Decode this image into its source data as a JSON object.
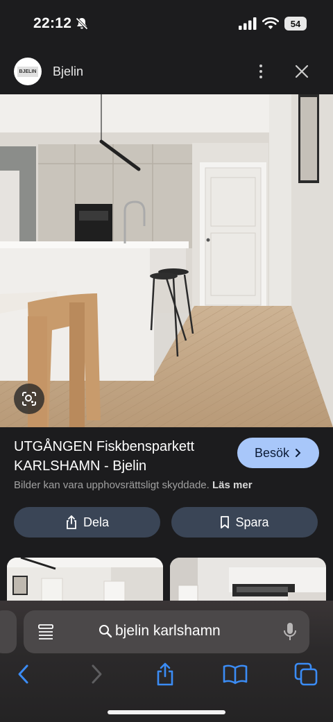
{
  "status_bar": {
    "time": "22:12",
    "battery": "54"
  },
  "header": {
    "site_name": "Bjelin",
    "logo_text": "BJELIN"
  },
  "result": {
    "title": "UTGÅNGEN Fiskbensparkett KARLSHAMN - Bjelin",
    "visit_label": "Besök",
    "copyright_notice": "Bilder kan vara upphovsrättsligt skyddade.",
    "learn_more_label": "Läs mer",
    "share_label": "Dela",
    "save_label": "Spara"
  },
  "browser": {
    "search_query": "bjelin karlshamn"
  },
  "colors": {
    "background": "#1c1c1e",
    "visit_button": "#a8c7fa",
    "action_button": "#3a4556",
    "nav_active": "#3b8cf5",
    "nav_disabled": "#5e5e60"
  },
  "icons": {
    "status": [
      "bell-off-icon",
      "signal-icon",
      "wifi-icon",
      "battery-icon"
    ],
    "header": [
      "kebab-menu-icon",
      "close-icon"
    ],
    "toolbar": [
      "back-icon",
      "forward-icon",
      "share-icon",
      "bookmarks-icon",
      "tabs-icon"
    ]
  }
}
